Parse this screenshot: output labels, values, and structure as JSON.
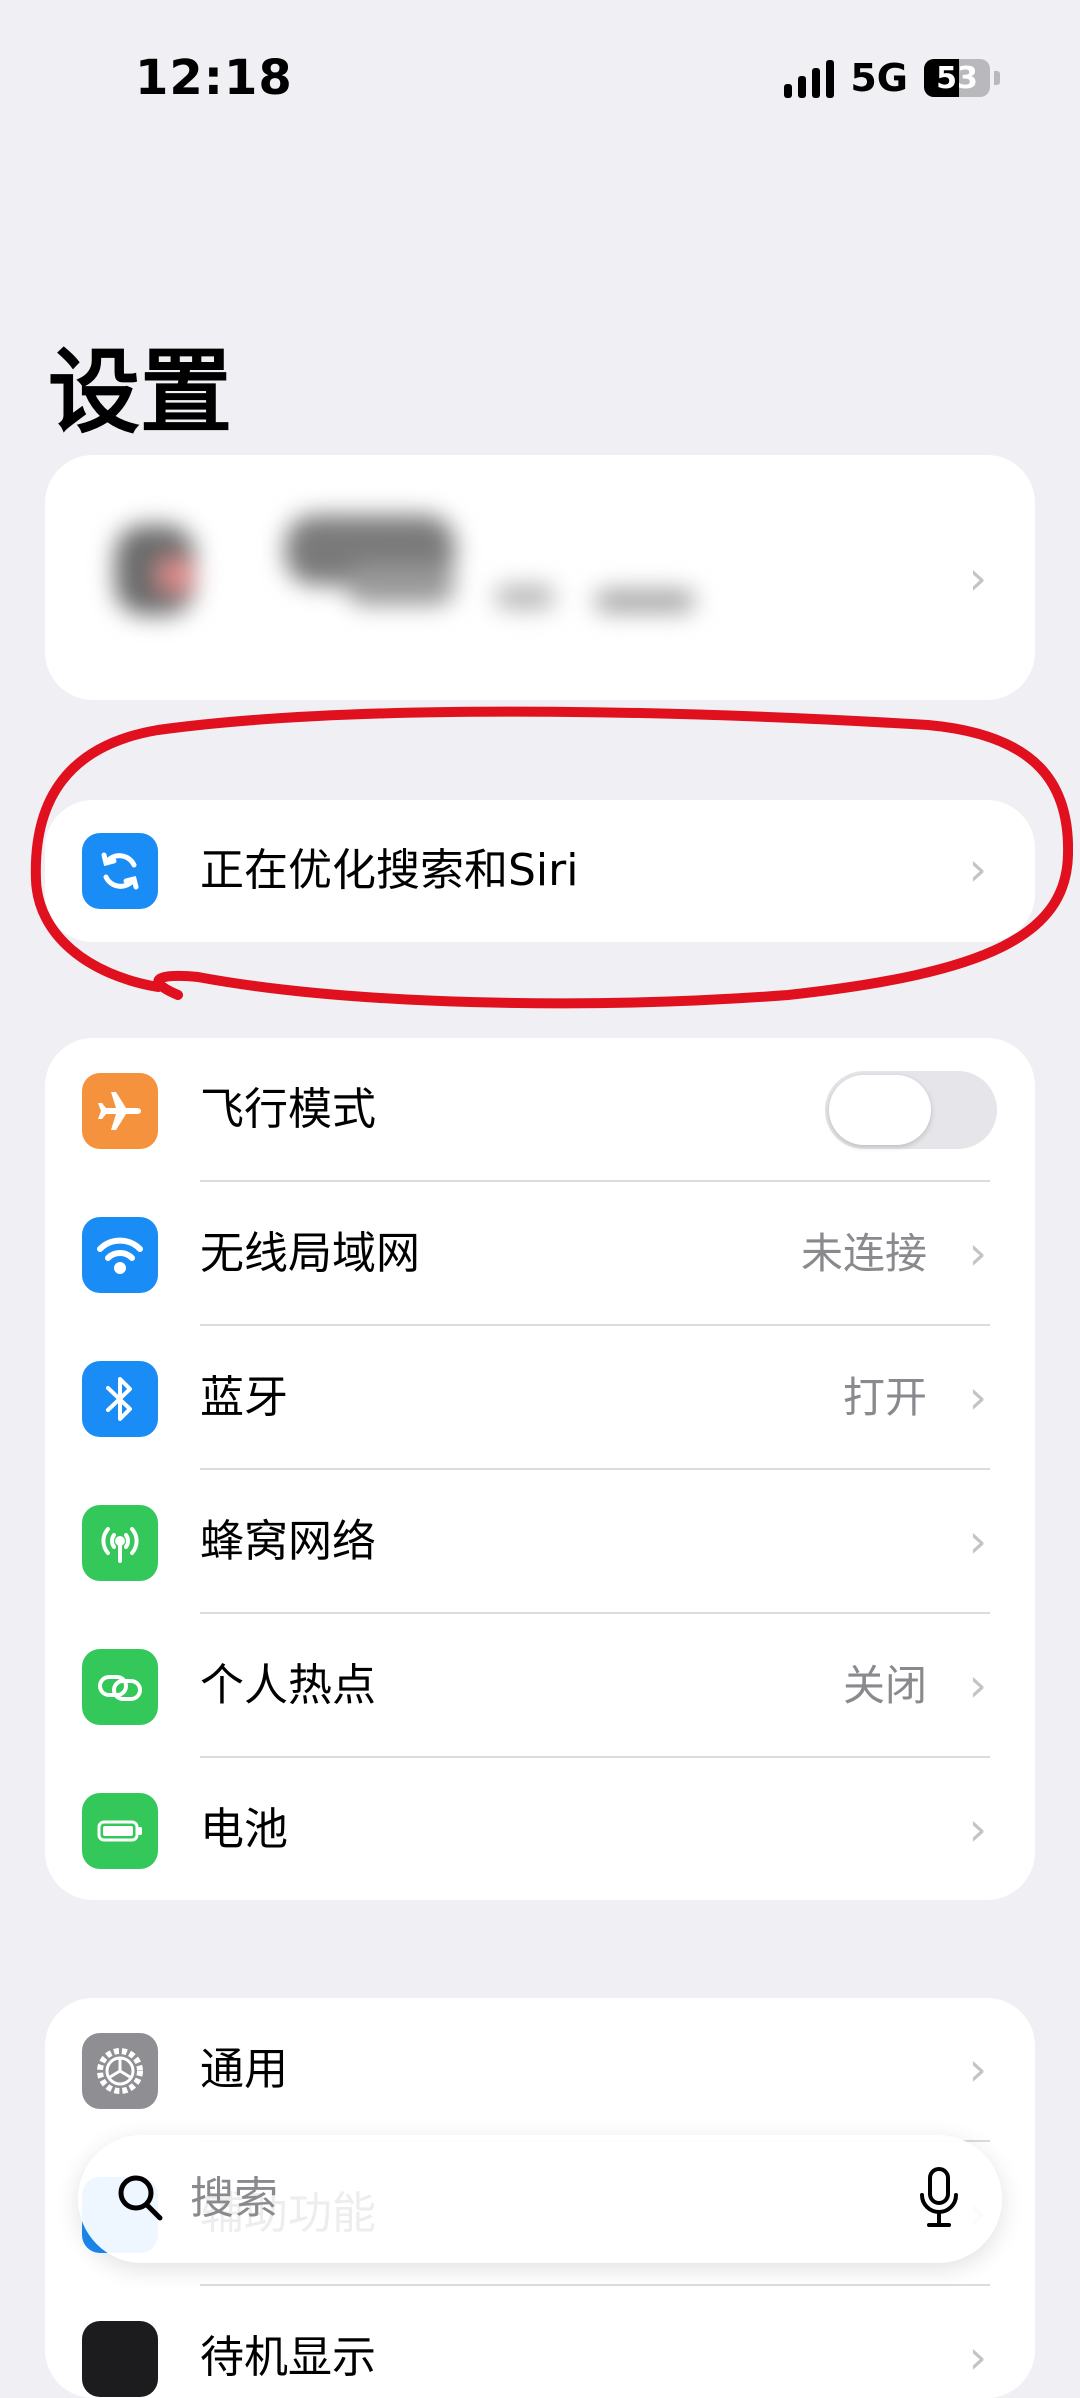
{
  "status_bar": {
    "time": "12:18",
    "network": "5G",
    "battery": "53"
  },
  "page": {
    "title": "设置"
  },
  "siri_item": {
    "label": "正在优化搜索和Siri"
  },
  "network_section": [
    {
      "label": "飞行模式",
      "value": "",
      "icon": "airplane-icon",
      "color": "#f5923e",
      "toggle": false
    },
    {
      "label": "无线局域网",
      "value": "未连接",
      "icon": "wifi-icon",
      "color": "#1a8cf5"
    },
    {
      "label": "蓝牙",
      "value": "打开",
      "icon": "bluetooth-icon",
      "color": "#1a8cf5"
    },
    {
      "label": "蜂窝网络",
      "value": "",
      "icon": "antenna-icon",
      "color": "#34c759"
    },
    {
      "label": "个人热点",
      "value": "关闭",
      "icon": "hotspot-icon",
      "color": "#34c759"
    },
    {
      "label": "电池",
      "value": "",
      "icon": "battery-icon",
      "color": "#34c759"
    }
  ],
  "general_section": [
    {
      "label": "通用",
      "icon": "gear-icon",
      "color": "#8e8e93"
    },
    {
      "label": "辅助功能",
      "icon": "accessibility-icon",
      "color": "#1a8cf5"
    },
    {
      "label": "待机显示",
      "icon": "standby-icon",
      "color": "#1c1c1e"
    }
  ],
  "search": {
    "placeholder": "搜索"
  },
  "colors": {
    "annotation": "#e0101e",
    "background": "#efeff4"
  }
}
